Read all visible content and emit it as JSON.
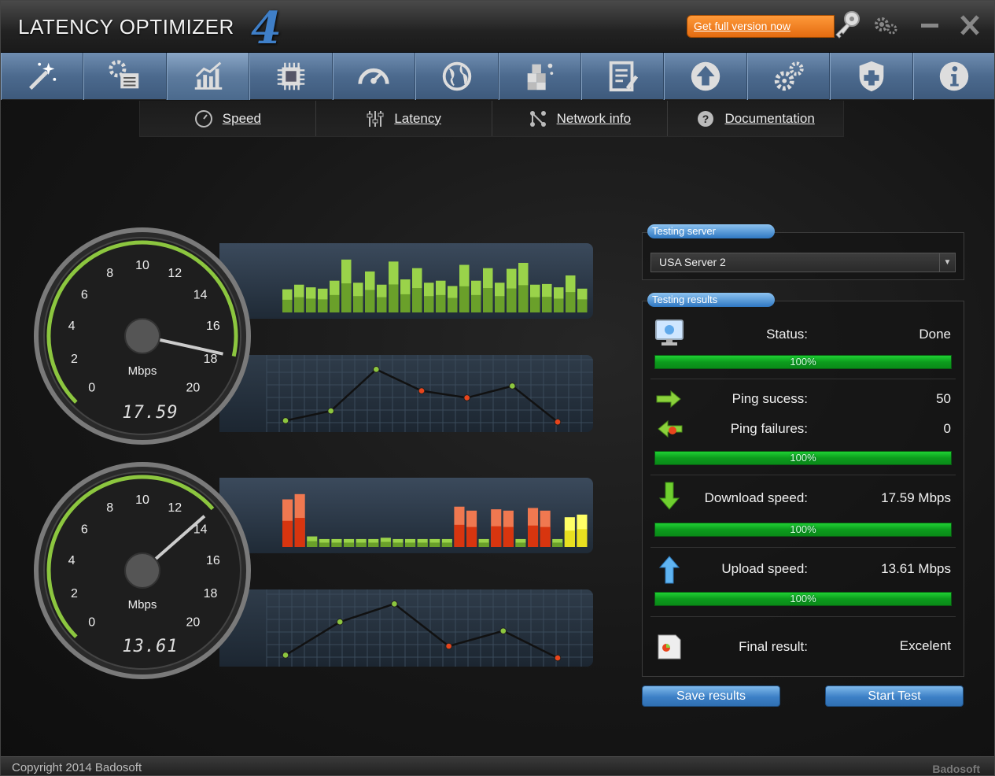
{
  "window": {
    "title": "LATENCY OPTIMIZER",
    "version_glyph": "4",
    "promo_label": "Get full version now"
  },
  "toolbar": {
    "items": [
      {
        "name": "wizard-icon"
      },
      {
        "name": "settings-list-icon"
      },
      {
        "name": "chart-icon",
        "active": true
      },
      {
        "name": "chip-icon"
      },
      {
        "name": "speedometer-icon"
      },
      {
        "name": "globe-icon"
      },
      {
        "name": "cubes-icon"
      },
      {
        "name": "notepad-icon"
      },
      {
        "name": "upload-icon"
      },
      {
        "name": "gears-icon"
      },
      {
        "name": "shield-icon"
      },
      {
        "name": "info-icon"
      }
    ]
  },
  "subnav": {
    "items": [
      {
        "label": "Speed",
        "icon": "speed-icon"
      },
      {
        "label": "Latency",
        "icon": "sliders-icon"
      },
      {
        "label": "Network info",
        "icon": "network-icon"
      },
      {
        "label": "Documentation",
        "icon": "help-icon"
      }
    ]
  },
  "gauges": {
    "unit": "Mbps",
    "ticks": [
      "0",
      "2",
      "4",
      "6",
      "8",
      "10",
      "12",
      "14",
      "16",
      "18",
      "20"
    ],
    "download": {
      "readout": "17.59",
      "value": 17.59,
      "bars": [
        {
          "v": 0.35,
          "c": "green"
        },
        {
          "v": 0.42,
          "c": "green"
        },
        {
          "v": 0.38,
          "c": "green"
        },
        {
          "v": 0.36,
          "c": "green"
        },
        {
          "v": 0.48,
          "c": "green"
        },
        {
          "v": 0.8,
          "c": "green"
        },
        {
          "v": 0.45,
          "c": "green"
        },
        {
          "v": 0.62,
          "c": "green"
        },
        {
          "v": 0.42,
          "c": "green"
        },
        {
          "v": 0.77,
          "c": "green"
        },
        {
          "v": 0.5,
          "c": "green"
        },
        {
          "v": 0.67,
          "c": "green"
        },
        {
          "v": 0.45,
          "c": "green"
        },
        {
          "v": 0.48,
          "c": "green"
        },
        {
          "v": 0.4,
          "c": "green"
        },
        {
          "v": 0.72,
          "c": "green"
        },
        {
          "v": 0.48,
          "c": "green"
        },
        {
          "v": 0.67,
          "c": "green"
        },
        {
          "v": 0.45,
          "c": "green"
        },
        {
          "v": 0.66,
          "c": "green"
        },
        {
          "v": 0.75,
          "c": "green"
        },
        {
          "v": 0.42,
          "c": "green"
        },
        {
          "v": 0.43,
          "c": "green"
        },
        {
          "v": 0.38,
          "c": "green"
        },
        {
          "v": 0.56,
          "c": "green"
        },
        {
          "v": 0.36,
          "c": "green"
        }
      ],
      "line": [
        {
          "v": 0.12,
          "c": "green"
        },
        {
          "v": 0.26,
          "c": "green"
        },
        {
          "v": 0.86,
          "c": "green"
        },
        {
          "v": 0.55,
          "c": "red"
        },
        {
          "v": 0.45,
          "c": "red"
        },
        {
          "v": 0.62,
          "c": "green"
        },
        {
          "v": 0.1,
          "c": "red"
        }
      ]
    },
    "upload": {
      "readout": "13.61",
      "value": 13.61,
      "bars": [
        {
          "v": 0.72,
          "c": "red"
        },
        {
          "v": 0.8,
          "c": "red"
        },
        {
          "v": 0.16,
          "c": "green"
        },
        {
          "v": 0.12,
          "c": "green"
        },
        {
          "v": 0.12,
          "c": "green"
        },
        {
          "v": 0.12,
          "c": "green"
        },
        {
          "v": 0.12,
          "c": "green"
        },
        {
          "v": 0.12,
          "c": "green"
        },
        {
          "v": 0.14,
          "c": "green"
        },
        {
          "v": 0.12,
          "c": "green"
        },
        {
          "v": 0.12,
          "c": "green"
        },
        {
          "v": 0.12,
          "c": "green"
        },
        {
          "v": 0.12,
          "c": "green"
        },
        {
          "v": 0.12,
          "c": "green"
        },
        {
          "v": 0.61,
          "c": "red"
        },
        {
          "v": 0.55,
          "c": "red"
        },
        {
          "v": 0.12,
          "c": "green"
        },
        {
          "v": 0.57,
          "c": "red"
        },
        {
          "v": 0.55,
          "c": "red"
        },
        {
          "v": 0.12,
          "c": "green"
        },
        {
          "v": 0.59,
          "c": "red"
        },
        {
          "v": 0.55,
          "c": "red"
        },
        {
          "v": 0.12,
          "c": "green"
        },
        {
          "v": 0.45,
          "c": "yellow"
        },
        {
          "v": 0.49,
          "c": "yellow"
        }
      ],
      "line": [
        {
          "v": 0.12,
          "c": "green"
        },
        {
          "v": 0.6,
          "c": "green"
        },
        {
          "v": 0.86,
          "c": "green"
        },
        {
          "v": 0.25,
          "c": "red"
        },
        {
          "v": 0.47,
          "c": "green"
        },
        {
          "v": 0.08,
          "c": "red"
        }
      ]
    }
  },
  "server": {
    "section_label": "Testing server",
    "selected": "USA Server 2"
  },
  "results": {
    "section_label": "Testing results",
    "status_label": "Status:",
    "status_value": "Done",
    "status_progress": "100%",
    "ping_success_label": "Ping sucess:",
    "ping_success_value": "50",
    "ping_failures_label": "Ping failures:",
    "ping_failures_value": "0",
    "ping_progress": "100%",
    "download_label": "Download speed:",
    "download_value": "17.59 Mbps",
    "download_progress": "100%",
    "upload_label": "Upload speed:",
    "upload_value": "13.61 Mbps",
    "upload_progress": "100%",
    "final_label": "Final result:",
    "final_value": "Excelent"
  },
  "actions": {
    "save_label": "Save results",
    "start_label": "Start Test"
  },
  "footer": {
    "copyright": "Copyright 2014 Badosoft",
    "brand": "Badosoft"
  },
  "colors": {
    "accent": "#3c80c6",
    "promo": "#f28a2a",
    "progress": "#14b828",
    "bar_green": "#8cc63f",
    "bar_red": "#e8451c",
    "bar_yellow": "#f2ef2a"
  }
}
